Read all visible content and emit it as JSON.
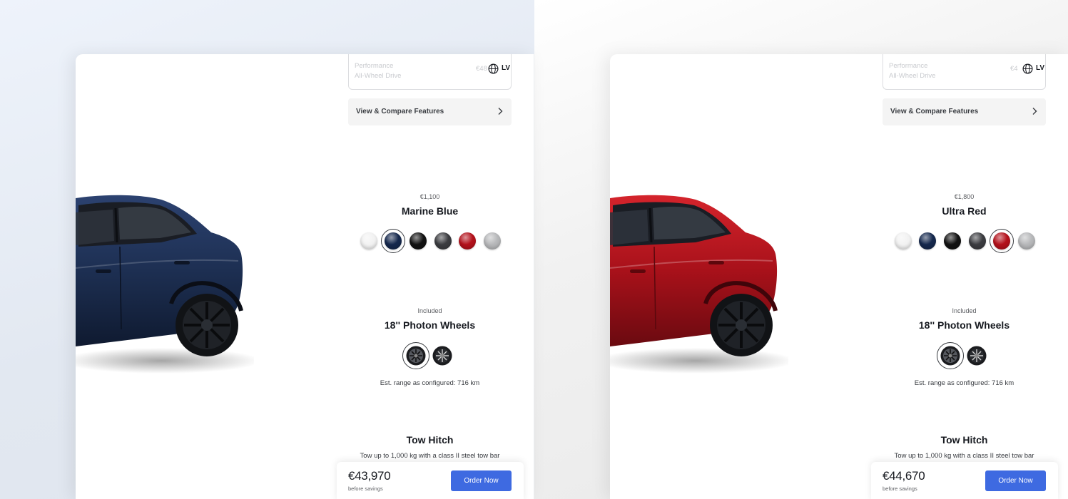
{
  "panels": [
    {
      "trim": {
        "line1": "Performance",
        "line2": "All-Wheel Drive",
        "price": "€48"
      },
      "language": "LV",
      "compare_label": "View & Compare Features",
      "paint": {
        "price": "€1,100",
        "name": "Marine Blue",
        "selected_index": 1,
        "body_color": "#1d2f52"
      },
      "wheels": {
        "price": "Included",
        "name": "18'' Photon Wheels",
        "selected_index": 0
      },
      "range": "Est. range as configured: 716 km",
      "tow": {
        "title": "Tow Hitch",
        "description": "Tow up to 1,000 kg with a class II steel tow bar"
      },
      "footer": {
        "total": "€43,970",
        "note": "before savings",
        "order_label": "Order Now"
      }
    },
    {
      "trim": {
        "line1": "Performance",
        "line2": "All-Wheel Drive",
        "price": "€4"
      },
      "language": "LV",
      "compare_label": "View & Compare Features",
      "paint": {
        "price": "€1,800",
        "name": "Ultra Red",
        "selected_index": 4,
        "body_color": "#a8111a"
      },
      "wheels": {
        "price": "Included",
        "name": "18'' Photon Wheels",
        "selected_index": 0
      },
      "range": "Est. range as configured: 716 km",
      "tow": {
        "title": "Tow Hitch",
        "description": "Tow up to 1,000 kg with a class II steel tow bar"
      },
      "footer": {
        "total": "€44,670",
        "note": "before savings",
        "order_label": "Order Now"
      }
    }
  ],
  "paint_swatches": [
    {
      "name": "Pearl White",
      "color": "#f2f2f2"
    },
    {
      "name": "Marine Blue",
      "color": "#15284d"
    },
    {
      "name": "Solid Black",
      "color": "#121212"
    },
    {
      "name": "Stealth Grey",
      "color": "#3b3c40"
    },
    {
      "name": "Ultra Red",
      "color": "#b3111b"
    },
    {
      "name": "Quicksilver",
      "color": "#b7b8ba"
    }
  ],
  "colors": {
    "accent": "#3e6ae1",
    "text": "#171a20",
    "muted": "#5c5e62"
  }
}
